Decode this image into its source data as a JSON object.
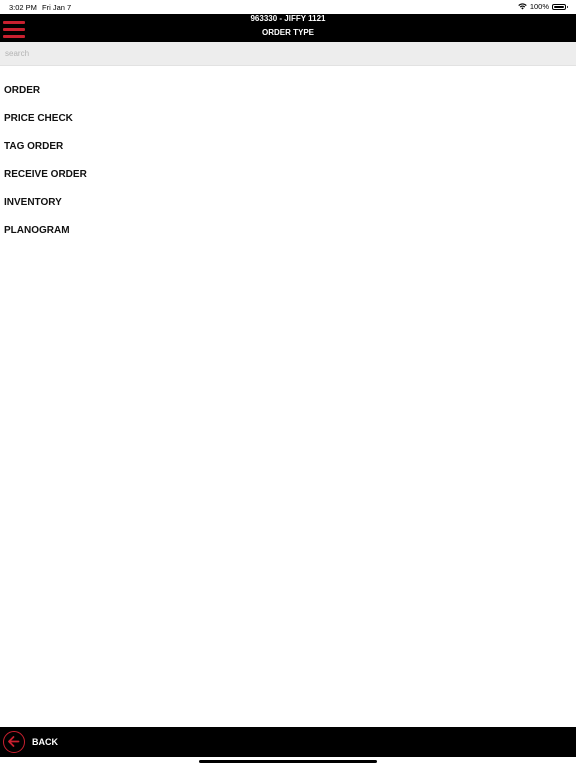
{
  "status_bar": {
    "time": "3:02 PM",
    "date": "Fri Jan 7",
    "battery": "100%",
    "icons": [
      "wifi-icon",
      "battery-icon"
    ]
  },
  "header": {
    "title": "963330 - JIFFY 1121",
    "subtitle": "ORDER TYPE",
    "menu_icon": "hamburger-menu-icon"
  },
  "search": {
    "placeholder": "search",
    "value": ""
  },
  "menu": {
    "items": [
      {
        "label": "ORDER"
      },
      {
        "label": "PRICE CHECK"
      },
      {
        "label": "TAG ORDER"
      },
      {
        "label": "RECEIVE ORDER"
      },
      {
        "label": "INVENTORY"
      },
      {
        "label": "PLANOGRAM"
      }
    ]
  },
  "footer": {
    "back_label": "BACK",
    "back_icon": "back-arrow-icon"
  },
  "colors": {
    "header_bg": "#000000",
    "accent": "#c8202f",
    "search_bg": "#ededed",
    "text": "#111111",
    "background": "#ffffff"
  }
}
